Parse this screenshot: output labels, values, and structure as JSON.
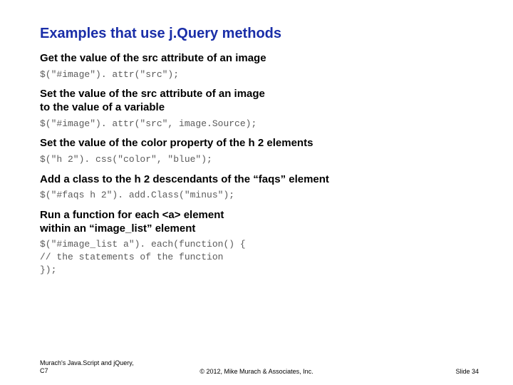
{
  "title": "Examples that use j.Query methods",
  "sections": [
    {
      "heading": "Get the value of the src attribute of an image",
      "code": "$(\"#image\"). attr(\"src\");"
    },
    {
      "heading": "Set the value of the src attribute of an image\nto the value of a variable",
      "code": "$(\"#image\"). attr(\"src\", image.Source);"
    },
    {
      "heading": "Set the value of the color property of the h 2 elements",
      "code": "$(\"h 2\"). css(\"color\", \"blue\");"
    },
    {
      "heading": "Add a class to the h 2 descendants of the “faqs” element",
      "code": "$(\"#faqs h 2\"). add.Class(\"minus\");"
    },
    {
      "heading": "Run a function for each <a> element\nwithin an “image_list” element",
      "code": "$(\"#image_list a\"). each(function() {\n// the statements of the function\n});"
    }
  ],
  "footer": {
    "left": "Murach's Java.Script and jQuery,\nC7",
    "center": "© 2012, Mike Murach & Associates, Inc.",
    "right": "Slide 34"
  }
}
